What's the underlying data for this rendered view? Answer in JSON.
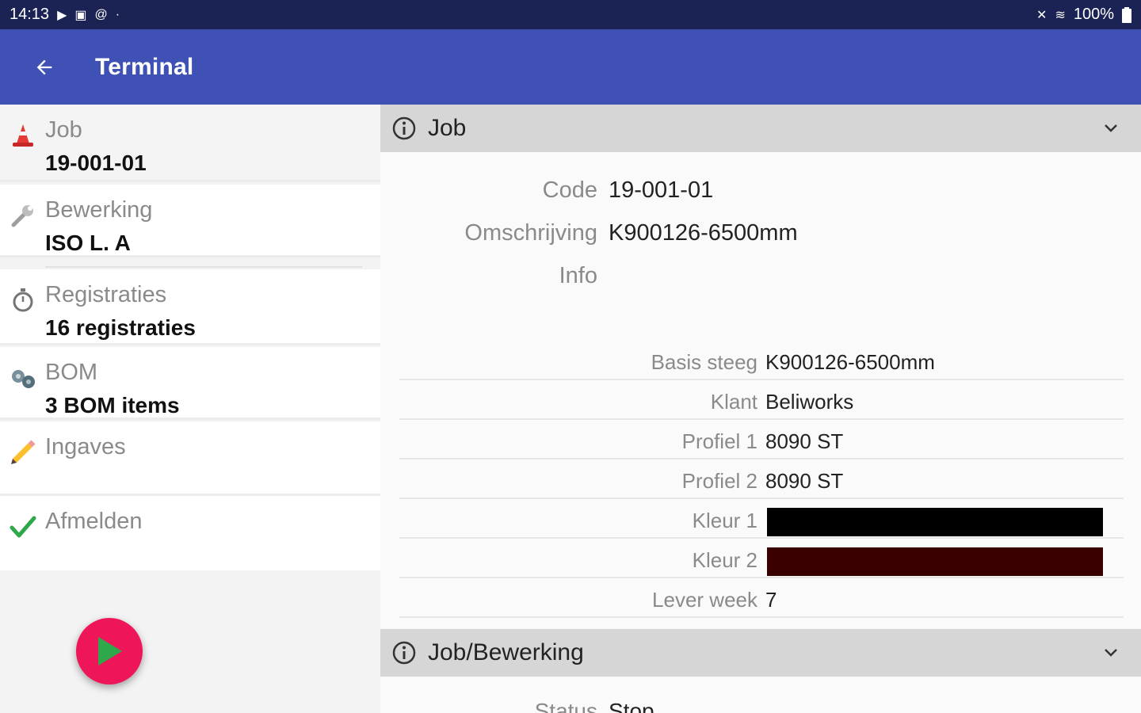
{
  "status_bar": {
    "time": "14:13",
    "left_icons": [
      "play-icon",
      "image-icon",
      "at-icon",
      "dot-icon"
    ],
    "battery": "100%"
  },
  "app_bar": {
    "title": "Terminal"
  },
  "menu": {
    "items": [
      {
        "label": "Job",
        "value": "19-001-01",
        "icon": "traffic-cone-icon"
      },
      {
        "label": "Bewerking",
        "value": "ISO L. A",
        "icon": "wrench-icon"
      },
      {
        "label": "Registraties",
        "value": "16 registraties",
        "icon": "stopwatch-icon"
      },
      {
        "label": "BOM",
        "value": "3 BOM items",
        "icon": "bolts-icon"
      },
      {
        "label": "Ingaves",
        "value": "",
        "icon": "pencil-icon"
      },
      {
        "label": "Afmelden",
        "value": "",
        "icon": "checkmark-icon"
      }
    ]
  },
  "job_section": {
    "title": "Job",
    "fields": [
      {
        "label": "Code",
        "value": "19-001-01"
      },
      {
        "label": "Omschrijving",
        "value": "K900126-6500mm"
      },
      {
        "label": "Info",
        "value": ""
      }
    ],
    "table": [
      {
        "label": "Basis steeg",
        "value": "K900126-6500mm"
      },
      {
        "label": "Klant",
        "value": "Beliworks"
      },
      {
        "label": "Profiel 1",
        "value": "8090 ST"
      },
      {
        "label": "Profiel 2",
        "value": "8090 ST"
      },
      {
        "label": "Kleur 1",
        "value": "",
        "color": "#000000"
      },
      {
        "label": "Kleur 2",
        "value": "",
        "color": "#3a0000"
      },
      {
        "label": "Lever week",
        "value": "7"
      }
    ]
  },
  "job_bewerking_section": {
    "title": "Job/Bewerking",
    "status_label": "Status",
    "status_value": "Stop"
  },
  "colors": {
    "app_bar": "#3f51b5",
    "status_bar": "#1a2353",
    "fab": "#ef1559",
    "fab_icon": "#2ea84a"
  }
}
